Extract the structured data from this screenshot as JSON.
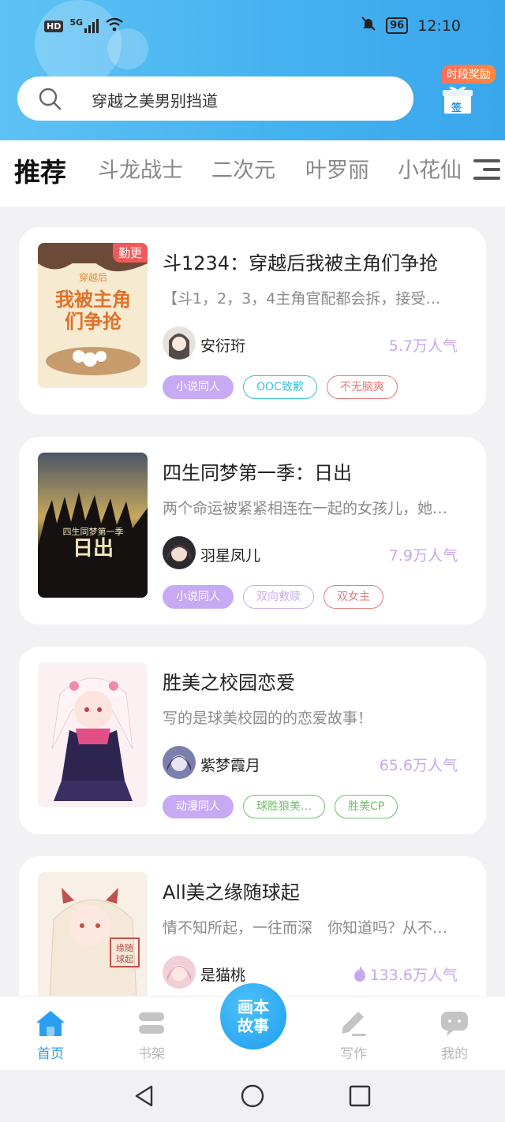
{
  "status_bar": {
    "hd": "HD",
    "network": "5G",
    "battery": "96",
    "time": "12:10"
  },
  "search": {
    "placeholder": "穿越之美男别挡道"
  },
  "reward": {
    "label": "时段奖励",
    "sign": "签"
  },
  "tabs": [
    {
      "label": "推荐",
      "active": true
    },
    {
      "label": "斗龙战士"
    },
    {
      "label": "二次元"
    },
    {
      "label": "叶罗丽"
    },
    {
      "label": "小花仙"
    }
  ],
  "books": [
    {
      "title": "斗1234：穿越后我被主角们争抢",
      "desc": "【斗1，2，3，4主角官配都会拆，接受…",
      "author": "安衍珩",
      "popularity": "5.7万人气",
      "badge": "勤更",
      "cover_text": "穿越后 我被主角们争抢",
      "tags": [
        {
          "label": "小说同人",
          "style": "filled"
        },
        {
          "label": "OOC致歉",
          "color": "#3fbfd8"
        },
        {
          "label": "不无脑爽",
          "color": "#e97a7a"
        }
      ]
    },
    {
      "title": "四生同梦第一季：日出",
      "desc": "两个命运被紧紧相连在一起的女孩儿，她…",
      "author": "羽星凤儿",
      "popularity": "7.9万人气",
      "cover_text": "四生同梦第一季 日出",
      "tags": [
        {
          "label": "小说同人",
          "style": "filled"
        },
        {
          "label": "双向救赎",
          "color": "#c8a9f3"
        },
        {
          "label": "双女主",
          "color": "#e97a7a"
        }
      ]
    },
    {
      "title": "胜美之校园恋爱",
      "desc": "写的是球美校园的的恋爱故事！",
      "author": "紫梦霞月",
      "popularity": "65.6万人气",
      "tags": [
        {
          "label": "动漫同人",
          "style": "filled"
        },
        {
          "label": "球胜狼美…",
          "color": "#6fbf6a"
        },
        {
          "label": "胜美CP",
          "color": "#6fbf6a"
        }
      ]
    },
    {
      "title": "All美之缘随球起",
      "desc": "情不知所起，一往而深　你知道吗？从不…",
      "author": "是猫桃",
      "popularity": "133.6万人气",
      "hot": true,
      "tags": []
    }
  ],
  "bottom_nav": {
    "home": "首页",
    "shelf": "书架",
    "center_line1": "画本",
    "center_line2": "故事",
    "write": "写作",
    "mine": "我的"
  },
  "colors": {
    "accent": "#2a9ff0",
    "purple": "#b08cf2",
    "popularity": "#c7a7ef"
  }
}
